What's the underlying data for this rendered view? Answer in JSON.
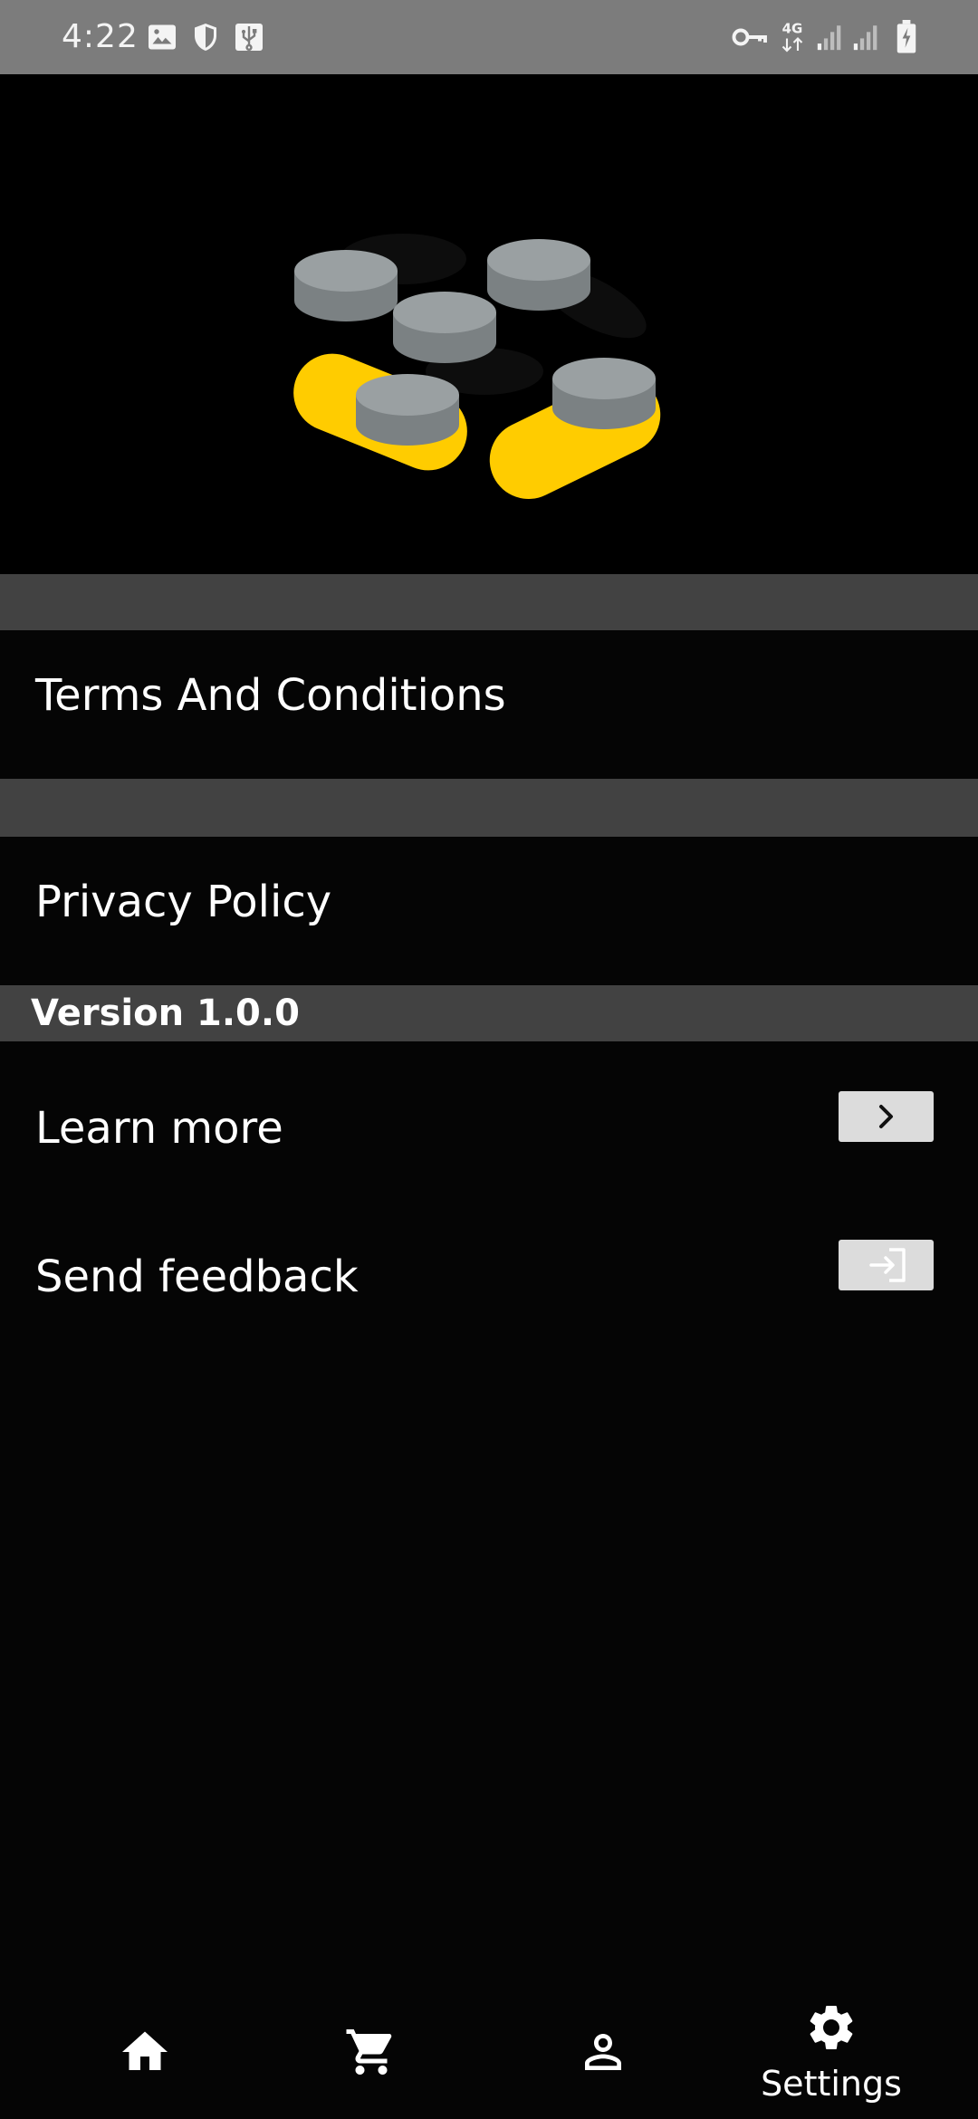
{
  "status_bar": {
    "time": "4:22",
    "left_icons": [
      "image-icon",
      "shield-icon",
      "usb-icon"
    ],
    "right_icons": [
      "vpn-key-icon",
      "network-4g-icon",
      "signal-icon",
      "signal-icon",
      "battery-charging-icon"
    ],
    "network_label": "4G"
  },
  "hero": {
    "logo": "app-logo",
    "colors": {
      "accent": "#ffcc00",
      "puck": "#939a9c"
    }
  },
  "menu": {
    "terms_label": "Terms And Conditions",
    "privacy_label": "Privacy Policy"
  },
  "version": {
    "text": "Version 1.0.0"
  },
  "actions": {
    "learn_more_label": "Learn more",
    "learn_more_icon": "chevron-right-icon",
    "send_feedback_label": "Send feedback",
    "send_feedback_icon": "login-arrow-icon"
  },
  "bottom_nav": {
    "items": [
      {
        "icon": "home-icon",
        "label": ""
      },
      {
        "icon": "cart-icon",
        "label": ""
      },
      {
        "icon": "person-icon",
        "label": ""
      },
      {
        "icon": "gear-icon",
        "label": "Settings",
        "active": true
      }
    ]
  },
  "colors": {
    "background": "#050505",
    "status_bar": "#7c7c7c",
    "divider": "#424242",
    "button_bg": "#dcdcdc",
    "text": "#ffffff"
  }
}
